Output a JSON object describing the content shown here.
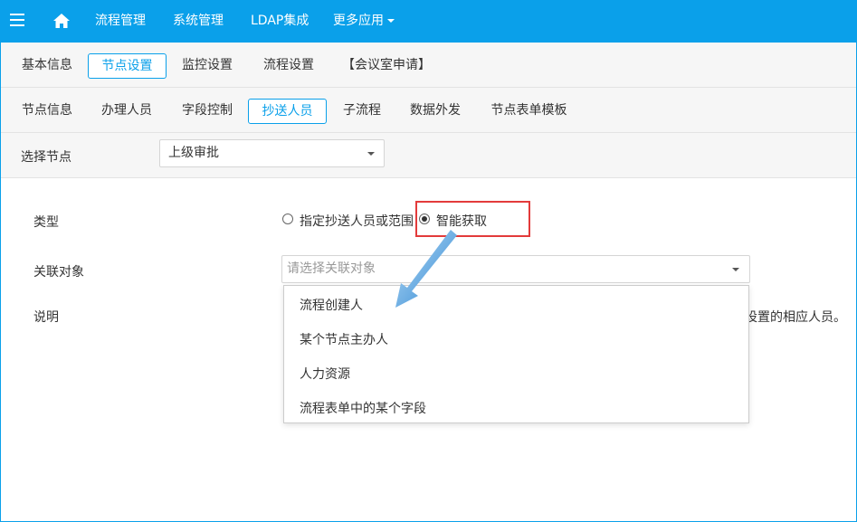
{
  "topbar": {
    "menu_icon": "hamburger-icon",
    "home_icon": "home-icon",
    "nav": [
      "流程管理",
      "系统管理",
      "LDAP集成",
      "更多应用"
    ]
  },
  "main_tabs": [
    "基本信息",
    "节点设置",
    "监控设置",
    "流程设置",
    "【会议室申请】"
  ],
  "sub_tabs": [
    "节点信息",
    "办理人员",
    "字段控制",
    "抄送人员",
    "子流程",
    "数据外发",
    "节点表单模板"
  ],
  "node_select": {
    "label": "选择节点",
    "value": "上级审批"
  },
  "form": {
    "type_label": "类型",
    "type_options": [
      "指定抄送人员或范围",
      "智能获取"
    ],
    "type_selected": "智能获取",
    "relation_label": "关联对象",
    "relation_placeholder": "请选择关联对象",
    "desc_label": "说明",
    "desc_text_right": "设置的相应人员。",
    "dropdown_options": [
      "流程创建人",
      "某个节点主办人",
      "人力资源",
      "流程表单中的某个字段"
    ]
  },
  "colors": {
    "accent": "#0aa0ea",
    "highlight_box": "#e33b3b",
    "annotation_arrow": "#3b8fd6"
  }
}
